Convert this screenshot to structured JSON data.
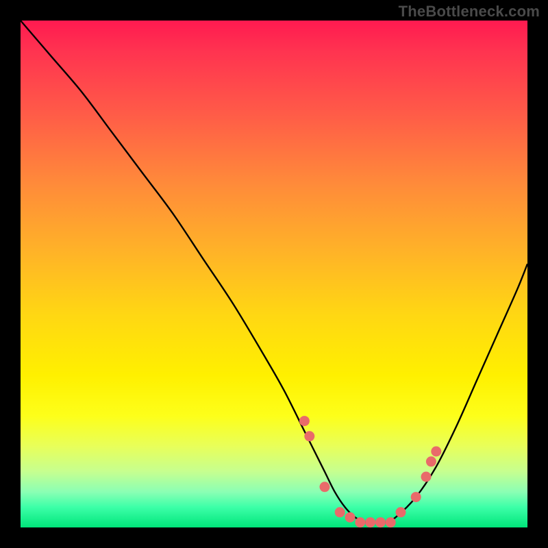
{
  "watermark": "TheBottleneck.com",
  "colors": {
    "frame": "#000000",
    "curve": "#000000",
    "marker_fill": "#e96a6a",
    "marker_stroke": "#d94f4f"
  },
  "chart_data": {
    "type": "line",
    "title": "",
    "xlabel": "",
    "ylabel": "",
    "xlim": [
      0,
      100
    ],
    "ylim": [
      0,
      100
    ],
    "grid": false,
    "series": [
      {
        "name": "bottleneck-curve",
        "x": [
          0,
          6,
          12,
          18,
          24,
          30,
          36,
          42,
          48,
          52,
          56,
          58,
          60,
          62,
          64,
          66,
          68,
          70,
          72,
          74,
          78,
          82,
          86,
          90,
          94,
          98,
          100
        ],
        "values": [
          100,
          93,
          86,
          78,
          70,
          62,
          53,
          44,
          34,
          27,
          19,
          15,
          11,
          7,
          4,
          2,
          1,
          1,
          1,
          2,
          6,
          12,
          20,
          29,
          38,
          47,
          52
        ]
      }
    ],
    "markers": {
      "name": "highlight-points",
      "x": [
        56,
        57,
        60,
        63,
        65,
        67,
        69,
        71,
        73,
        75,
        78,
        80,
        81,
        82
      ],
      "values": [
        21,
        18,
        8,
        3,
        2,
        1,
        1,
        1,
        1,
        3,
        6,
        10,
        13,
        15
      ]
    }
  }
}
